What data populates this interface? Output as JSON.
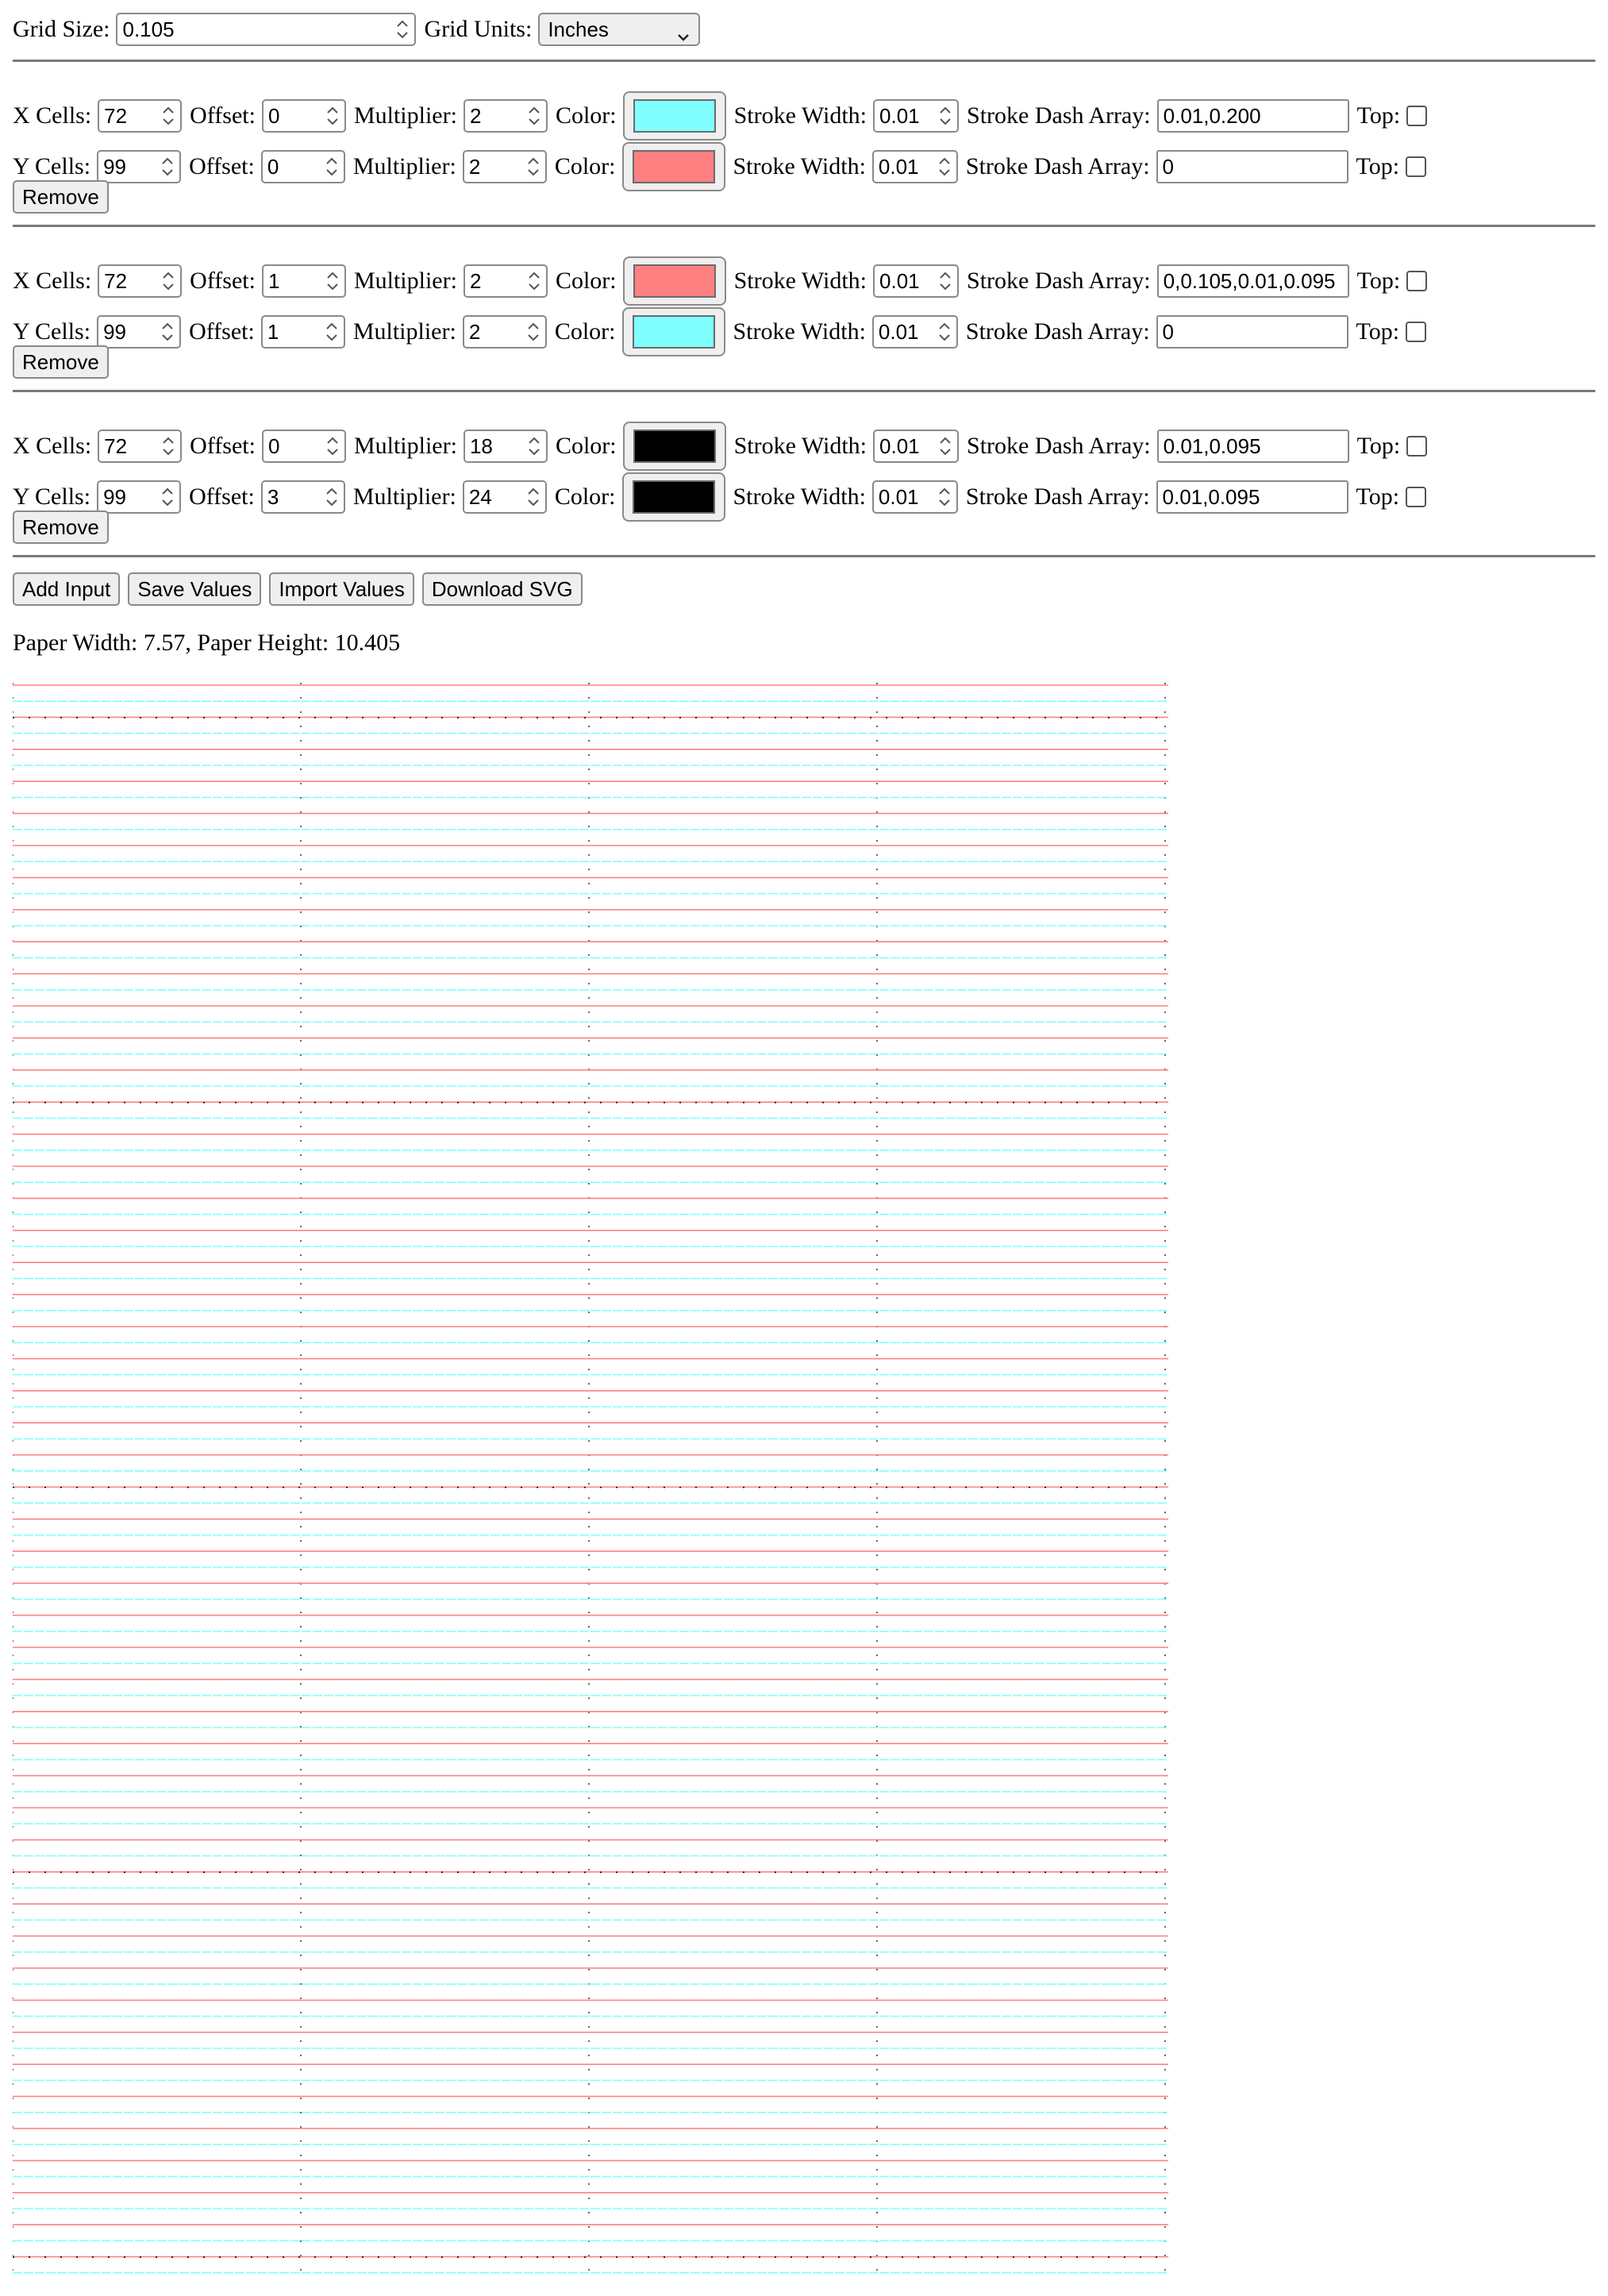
{
  "top_controls": {
    "grid_size_label": "Grid Size:",
    "grid_size_value": "0.105",
    "grid_units_label": "Grid Units:",
    "grid_units_value": "Inches"
  },
  "labels": {
    "x_cells": "X Cells:",
    "y_cells": "Y Cells:",
    "offset": "Offset:",
    "multiplier": "Multiplier:",
    "color": "Color:",
    "stroke_width": "Stroke Width:",
    "stroke_dash_array": "Stroke Dash Array:",
    "top": "Top:",
    "remove": "Remove"
  },
  "input_groups": [
    {
      "x": {
        "cells": "72",
        "offset": "0",
        "multiplier": "2",
        "color": "#80ffff",
        "stroke_width": "0.01",
        "dash": "0.01,0.200",
        "top": false
      },
      "y": {
        "cells": "99",
        "offset": "0",
        "multiplier": "2",
        "color": "#ff8080",
        "stroke_width": "0.01",
        "dash": "0",
        "top": false
      }
    },
    {
      "x": {
        "cells": "72",
        "offset": "1",
        "multiplier": "2",
        "color": "#ff8080",
        "stroke_width": "0.01",
        "dash": "0,0.105,0.01,0.095",
        "top": false
      },
      "y": {
        "cells": "99",
        "offset": "1",
        "multiplier": "2",
        "color": "#80ffff",
        "stroke_width": "0.01",
        "dash": "0",
        "top": false
      }
    },
    {
      "x": {
        "cells": "72",
        "offset": "0",
        "multiplier": "18",
        "color": "#000000",
        "stroke_width": "0.01",
        "dash": "0.01,0.095",
        "top": false
      },
      "y": {
        "cells": "99",
        "offset": "3",
        "multiplier": "24",
        "color": "#000000",
        "stroke_width": "0.01",
        "dash": "0.01,0.095",
        "top": false
      }
    }
  ],
  "actions": {
    "add_input": "Add Input",
    "save_values": "Save Values",
    "import_values": "Import Values",
    "download_svg": "Download SVG"
  },
  "paper_info": "Paper Width: 7.57, Paper Height: 10.405",
  "grid_colors": {
    "red": "#ff8080",
    "cyan": "#80ffff",
    "black": "#000000"
  }
}
